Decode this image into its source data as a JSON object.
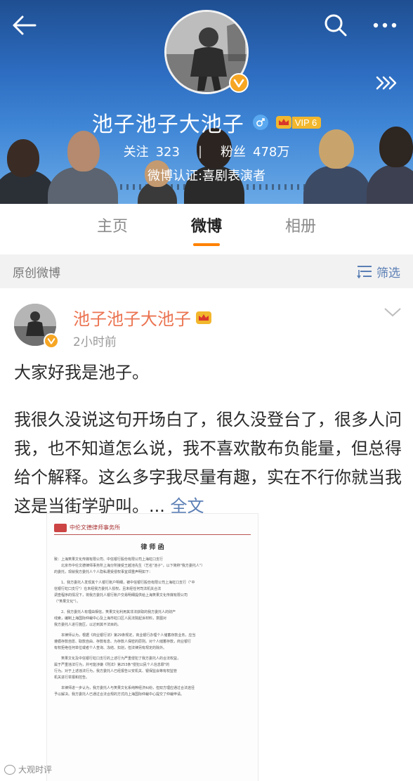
{
  "header": {
    "profile_name": "池子池子大池子",
    "vip_label": "VIP 6",
    "following_label": "关注",
    "following_count": "323",
    "followers_label": "粉丝",
    "followers_count": "478万",
    "stats_divider": "|",
    "verification": "微博认证:喜剧表演者"
  },
  "tabs": [
    {
      "label": "主页",
      "active": false
    },
    {
      "label": "微博",
      "active": true
    },
    {
      "label": "相册",
      "active": false
    }
  ],
  "filter_bar": {
    "label": "原创微博",
    "filter_button": "筛选"
  },
  "post": {
    "author": "池子池子大池子",
    "time": "2小时前",
    "paragraph1": "大家好我是池子。",
    "paragraph2": "我很久没说这句开场白了，很久没登台了，很多人问我，也不知道怎么说，我不喜欢散布负能量，但总得给个解释。这么多字我尽量有趣，实在不行你就当我这是当街学驴叫。... ",
    "full_text_link": "全文"
  },
  "letter_image": {
    "firm": "中伦文德律师事务所",
    "title": "律 师 函",
    "lines": [
      "致：上海笑果文化传媒有限公司、中信银行股份有限公司上海虹口支行",
      "北京市中伦文德律师事务所上海分所接受王越池先生（艺名\"池子\"，以下简称\"我方委托人\"）",
      "的委托，现就我方委托人个人隐私遭受侵权事宜郑重声明如下：",
      "1、我方委托人发现其个人银行账户明细，被中信银行股份有限公司上海虹口支行（\"中",
      "信银行虹口支行\"）在未经我方委托人授权，且未经任何司法机关合法",
      "调查程序的情况下，将我方委托人银行账户交易明细提供给上海笑果文化传媒有限公司",
      "（\"笑果文化\"）。",
      "2、我方委托人有理由相信，笑果文化利用其非法获取的我方委托人的财产",
      "线索，编制上海国际仲裁中心及上海市虹口区人民法院起诉材料，意图对",
      "我方委托人进行施压，以达到其不法目的。",
      "本律师认为，根据《商业银行法》第29条规定，商业银行办理个人储蓄存款业务，应当",
      "遵循存款自愿、取款自由、存款有息、为存款人保密的原则。对个人储蓄存款，商业银行",
      "有权拒绝任何单位或者个人查询、冻结、扣划，但法律另有规定的除外。",
      "笑果文化及中信银行虹口支行的上述行为严重侵犯了我方委托人的合法权益，",
      "属于严重违法行为，并可能涉嫌《刑法》第253条\"侵犯公民个人信息罪\"的",
      "行为。对于上述违法行为，我方委托人已经报告公安机关、银保监会等有权监管",
      "机关进行举报和控告。",
      "本律师进一步认为，我方委托人与笑果文化系纯粹经济纠纷，但双方理应通过合法途径",
      "予以解决。我方委托人已通过合法合规的方式向上海国际仲裁中心提交了仲裁申请。"
    ]
  },
  "watermark": "大观时评",
  "colors": {
    "accent_orange": "#ff8200",
    "author_orange": "#eb7350",
    "link_blue": "#5b7fb5",
    "verify_badge": "#f6a623"
  },
  "icons": [
    "back-arrow-icon",
    "search-icon",
    "more-icon",
    "forward-icon",
    "verified-v-icon",
    "male-icon",
    "vip-crown-icon",
    "filter-icon",
    "chevron-down-icon"
  ]
}
